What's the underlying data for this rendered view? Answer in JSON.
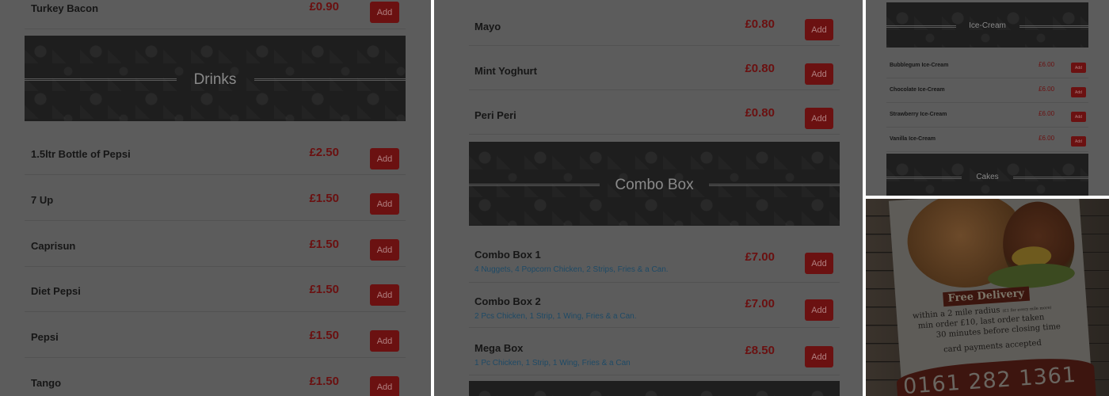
{
  "panel1": {
    "top_item": {
      "name": "Turkey Bacon",
      "price": "£0.90",
      "add": "Add"
    },
    "section": "Drinks",
    "items": [
      {
        "name": "1.5ltr Bottle of Pepsi",
        "price": "£2.50",
        "add": "Add"
      },
      {
        "name": "7 Up",
        "price": "£1.50",
        "add": "Add"
      },
      {
        "name": "Caprisun",
        "price": "£1.50",
        "add": "Add"
      },
      {
        "name": "Diet Pepsi",
        "price": "£1.50",
        "add": "Add"
      },
      {
        "name": "Pepsi",
        "price": "£1.50",
        "add": "Add"
      },
      {
        "name": "Tango",
        "price": "£1.50",
        "add": "Add"
      }
    ]
  },
  "panel2": {
    "sauces": [
      {
        "name": "Mayo",
        "price": "£0.80",
        "add": "Add"
      },
      {
        "name": "Mint Yoghurt",
        "price": "£0.80",
        "add": "Add"
      },
      {
        "name": "Peri Peri",
        "price": "£0.80",
        "add": "Add"
      }
    ],
    "section": "Combo Box",
    "combos": [
      {
        "name": "Combo Box 1",
        "desc": "4 Nuggets, 4 Popcorn Chicken, 2 Strips, Fries & a Can.",
        "price": "£7.00",
        "add": "Add"
      },
      {
        "name": "Combo Box 2",
        "desc": "2 Pcs Chicken, 1 Strip, 1 Wing, Fries & a Can.",
        "price": "£7.00",
        "add": "Add"
      },
      {
        "name": "Mega Box",
        "desc": "1 Pc Chicken, 1 Strip, 1 Wing, Fries & a Can",
        "price": "£8.50",
        "add": "Add"
      }
    ]
  },
  "panel3": {
    "section": "Ice-Cream",
    "items": [
      {
        "name": "Bubblegum Ice-Cream",
        "price": "£6.00",
        "add": "Add"
      },
      {
        "name": "Chocolate Ice-Cream",
        "price": "£6.00",
        "add": "Add"
      },
      {
        "name": "Strawberry Ice-Cream",
        "price": "£6.00",
        "add": "Add"
      },
      {
        "name": "Vanilla Ice-Cream",
        "price": "£6.00",
        "add": "Add"
      }
    ],
    "next_section": "Cakes"
  },
  "flyer": {
    "headline": "Free Delivery",
    "line1": "within a 2 mile radius",
    "line1_small": "(£1 for every mile more)",
    "line2": "min order £10, last order taken",
    "line3": "30 minutes before closing time",
    "line4": "card payments accepted",
    "phone": "0161 282 1361"
  },
  "colors": {
    "overlay_bg": "#5c5c5c",
    "price": "#6a1010",
    "add_button": "#6b1111",
    "banner": "#1e1e1e",
    "description": "#1e4a66"
  }
}
